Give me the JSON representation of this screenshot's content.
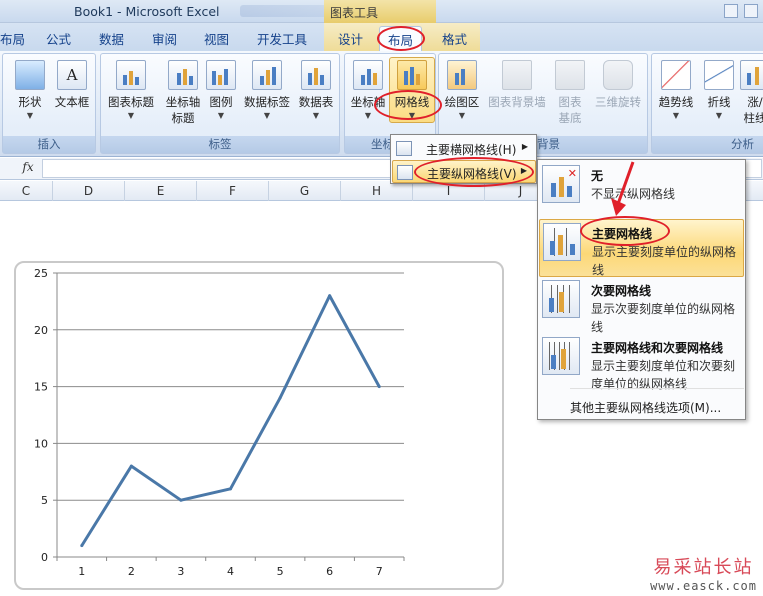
{
  "window": {
    "title": "Book1 - Microsoft Excel",
    "context_tab_title": "图表工具"
  },
  "tabs": [
    "布局",
    "公式",
    "数据",
    "审阅",
    "视图",
    "开发工具",
    "设计",
    "布局",
    "格式"
  ],
  "ribbon": {
    "groups": [
      {
        "label": "插入",
        "buttons": [
          "形状",
          "文本框"
        ]
      },
      {
        "label": "标签",
        "buttons": [
          "图表标题",
          "坐标轴\n标题",
          "图例",
          "数据标签",
          "数据表"
        ]
      },
      {
        "label": "坐标",
        "buttons": [
          "坐标轴",
          "网格线"
        ]
      },
      {
        "label": "背景",
        "buttons": [
          "绘图区",
          "图表背景墙",
          "图表\n基底",
          "三维旋转"
        ]
      },
      {
        "label": "分析",
        "buttons": [
          "趋势线",
          "折线",
          "涨/\n柱线"
        ]
      }
    ]
  },
  "formula_bar": {
    "fx": "fx"
  },
  "columns": [
    "C",
    "D",
    "E",
    "F",
    "G",
    "H",
    "I",
    "J"
  ],
  "gridlines_menu": {
    "items": [
      {
        "label": "主要横网格线(H)"
      },
      {
        "label": "主要纵网格线(V)"
      }
    ]
  },
  "vertical_gridlines_submenu": {
    "options": [
      {
        "title": "无",
        "desc": "不显示纵网格线"
      },
      {
        "title": "主要网格线",
        "desc": "显示主要刻度单位的纵网格线"
      },
      {
        "title": "次要网格线",
        "desc": "显示次要刻度单位的纵网格线"
      },
      {
        "title": "主要网格线和次要网格线",
        "desc": "显示主要刻度单位和次要刻度单位的纵网格线"
      }
    ],
    "more": "其他主要纵网格线选项(M)..."
  },
  "watermark": {
    "line1": "易采站长站",
    "line2": "www.easck.com"
  },
  "colors": {
    "line": "#4a78a8",
    "annotation": "#e0202a"
  },
  "chart_data": {
    "type": "line",
    "categories": [
      "1",
      "2",
      "3",
      "4",
      "5",
      "6",
      "7"
    ],
    "values": [
      1,
      8,
      5,
      6,
      14,
      23,
      15
    ],
    "ylim": [
      0,
      25
    ],
    "yticks": [
      0,
      5,
      10,
      15,
      20,
      25
    ],
    "title": "",
    "xlabel": "",
    "ylabel": "",
    "grid": "horizontal major"
  }
}
